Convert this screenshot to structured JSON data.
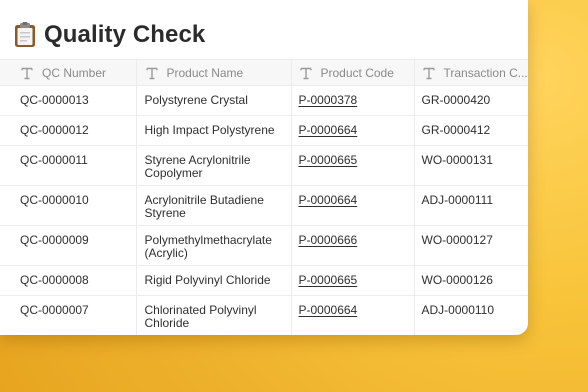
{
  "page": {
    "title": "Quality Check",
    "title_icon": "clipboard-icon"
  },
  "table": {
    "columns": [
      {
        "label": "QC Number",
        "icon": "text-property-icon"
      },
      {
        "label": "Product Name",
        "icon": "text-property-icon"
      },
      {
        "label": "Product Code",
        "icon": "text-property-icon"
      },
      {
        "label": "Transaction C...",
        "icon": "text-property-icon"
      }
    ],
    "rows": [
      {
        "qc": "QC-0000013",
        "name": "Polystyrene Crystal",
        "code": "P-0000378",
        "txn": "GR-0000420"
      },
      {
        "qc": "QC-0000012",
        "name": "High Impact Polystyrene",
        "code": "P-0000664",
        "txn": "GR-0000412"
      },
      {
        "qc": "QC-0000011",
        "name": "Styrene Acrylonitrile Copolymer",
        "code": "P-0000665",
        "txn": "WO-0000131"
      },
      {
        "qc": "QC-0000010",
        "name": "Acrylonitrile Butadiene Styrene",
        "code": "P-0000664",
        "txn": "ADJ-0000111"
      },
      {
        "qc": "QC-0000009",
        "name": "Polymethylmethacrylate (Acrylic)",
        "code": "P-0000666",
        "txn": "WO-0000127"
      },
      {
        "qc": "QC-0000008",
        "name": "Rigid Polyvinyl Chloride",
        "code": "P-0000665",
        "txn": "WO-0000126"
      },
      {
        "qc": "QC-0000007",
        "name": "Chlorinated Polyvinyl Chloride",
        "code": "P-0000664",
        "txn": "ADJ-0000110"
      }
    ]
  },
  "colors": {
    "background_accent": "#f8c43a",
    "card": "#ffffff",
    "header_text": "#8a8a8a",
    "body_text": "#2f2f2f"
  }
}
